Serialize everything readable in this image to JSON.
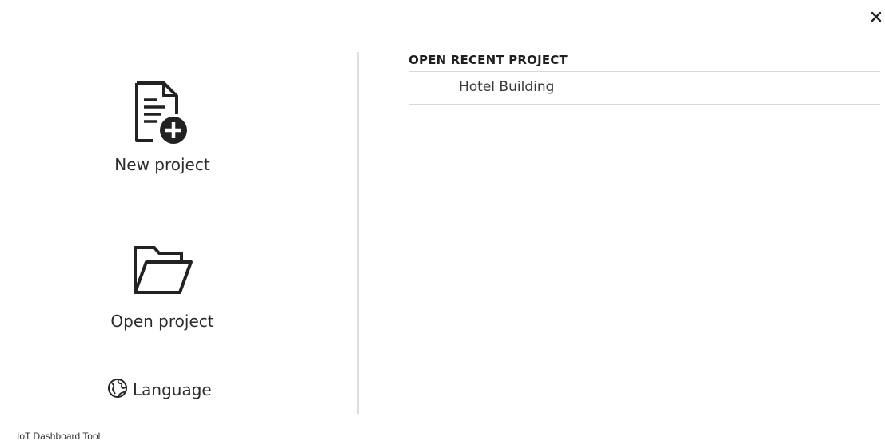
{
  "window": {
    "close_icon": "close-icon"
  },
  "actions": {
    "new_project": {
      "label": "New project",
      "icon": "new-document-plus-icon"
    },
    "open_project": {
      "label": "Open project",
      "icon": "open-folder-icon"
    },
    "language": {
      "label": "Language",
      "icon": "globe-icon"
    }
  },
  "recent": {
    "title": "OPEN RECENT PROJECT",
    "items": [
      {
        "label": "Hotel Building"
      }
    ]
  },
  "footer": {
    "app_name": "IoT Dashboard Tool"
  },
  "colors": {
    "text": "#262626",
    "divider": "#dedede",
    "row_border": "#d9d9d9",
    "icon": "#222222"
  }
}
